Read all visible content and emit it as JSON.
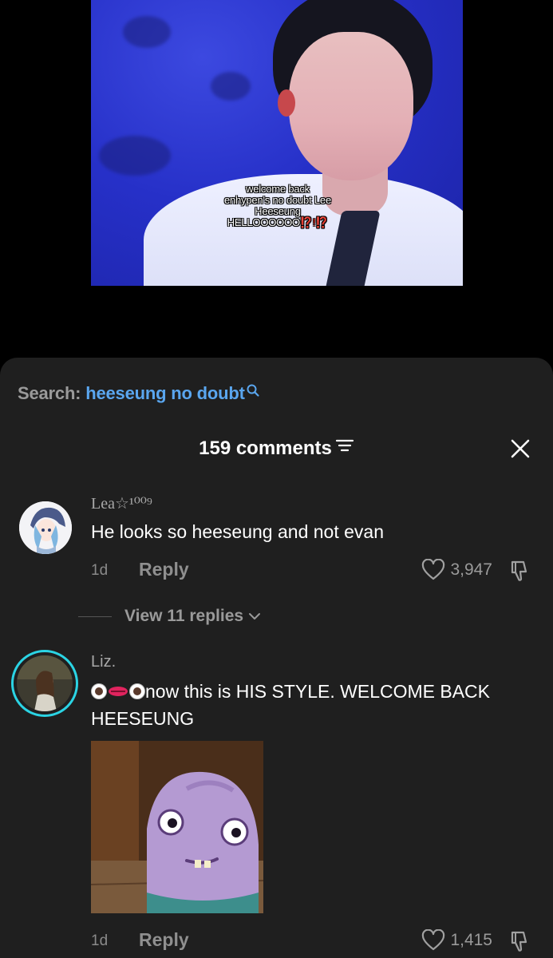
{
  "video": {
    "caption_line1": "welcome back",
    "caption_line2": "enhypen's no doubt Lee",
    "caption_line3": "Heeseung",
    "caption_line4": "HELLOOOOOO",
    "caption_punct": "⁉️!⁉️"
  },
  "search": {
    "label": "Search:",
    "query": "heeseung no doubt",
    "icon": "search-icon"
  },
  "header": {
    "comment_count": "159 comments",
    "sort_icon": "sort-icon",
    "close_icon": "close-icon"
  },
  "comments": [
    {
      "username": "Lea☆¹⁰⁰⁹",
      "text": "He looks so heeseung and not evan",
      "age": "1d",
      "reply_label": "Reply",
      "likes": "3,947",
      "view_replies": "View 11 replies"
    },
    {
      "username": "Liz.",
      "text": "now this is HIS STYLE. WELCOME BACK HEESEUNG",
      "emoji": "👁️👄👁️",
      "age": "1d",
      "reply_label": "Reply",
      "likes": "1,415",
      "has_sticker": true
    }
  ],
  "colors": {
    "sheet_bg": "#1f1f1f",
    "search_query": "#5aa6ef",
    "story_ring": "#2bd4e4"
  }
}
